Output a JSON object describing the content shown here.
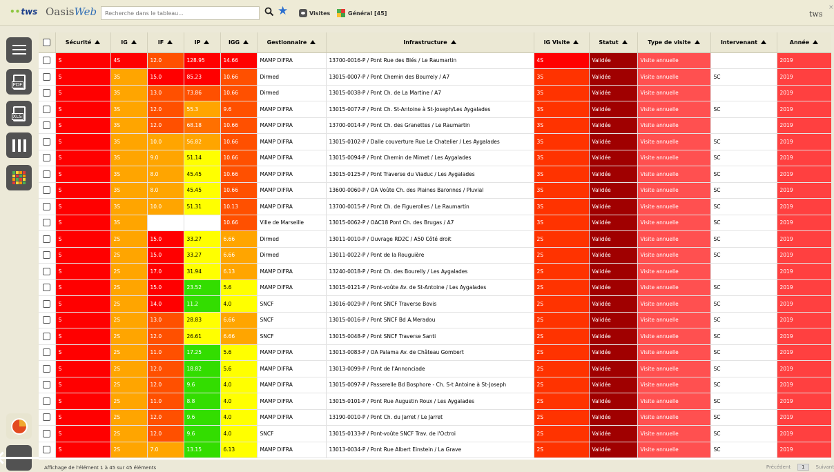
{
  "header": {
    "brand_tws": "tws",
    "brand_oasis": "Oasis",
    "brand_web": "Web",
    "search_placeholder": "Recherche dans le tableau...",
    "visites_label": "Visites",
    "general_label": "Général [45]",
    "user_label": "tws",
    "close_label": "×",
    "star_color": "#2c70cf"
  },
  "sidebar": {
    "items": [
      "menu-icon",
      "pdf-export-icon",
      "xls-export-icon",
      "columns-icon",
      "heatmap-icon",
      "pie-chart-icon",
      "back-arrow-icon"
    ],
    "pdf_tag": "PDF",
    "xls_tag": "XLS"
  },
  "table": {
    "columns": [
      "Sécurité",
      "IG",
      "IF",
      "IP",
      "IGG",
      "Gestionnaire",
      "Infrastructure",
      "IG Visite",
      "Statut",
      "Type de visite",
      "Intervenant",
      "Année"
    ],
    "rows": [
      {
        "securite": "S",
        "ig": "4S",
        "if": "12.0",
        "ip": "128.95",
        "igg": "14.66",
        "gest": "MAMP DIFRA",
        "infra": "13700-0016-P / Pont Rue des Blés / Le Raumartin",
        "igv": "4S",
        "statut": "Validée",
        "type": "Visite annuelle",
        "interv": "",
        "annee": "2019",
        "c_ig": "#ff0000",
        "c_if": "#ff5000",
        "c_ip": "#ff0000",
        "c_igg": "#ff0000",
        "c_igv": "#ff0000"
      },
      {
        "securite": "S",
        "ig": "3S",
        "if": "15.0",
        "ip": "85.23",
        "igg": "10.66",
        "gest": "Dirmed",
        "infra": "13015-0007-P / Pont Chemin des Bourrely / A7",
        "igv": "3S",
        "statut": "Validée",
        "type": "Visite annuelle",
        "interv": "SC",
        "annee": "2019",
        "c_ig": "#ffa500",
        "c_if": "#ff0000",
        "c_ip": "#ff0000",
        "c_igg": "#ff5000",
        "c_igv": "#ff3300"
      },
      {
        "securite": "S",
        "ig": "3S",
        "if": "13.0",
        "ip": "73.86",
        "igg": "10.66",
        "gest": "Dirmed",
        "infra": "13015-0038-P / Pont Ch. de La Martine / A7",
        "igv": "3S",
        "statut": "Validée",
        "type": "Visite annuelle",
        "interv": "",
        "annee": "2019",
        "c_ig": "#ffa500",
        "c_if": "#ff5000",
        "c_ip": "#ff5000",
        "c_igg": "#ff5000",
        "c_igv": "#ff3300"
      },
      {
        "securite": "S",
        "ig": "3S",
        "if": "12.0",
        "ip": "55.3",
        "igg": "9.6",
        "gest": "MAMP DIFRA",
        "infra": "13015-0077-P / Pont Ch. St-Antoine à St-Joseph/Les Aygalades",
        "igv": "3S",
        "statut": "Validée",
        "type": "Visite annuelle",
        "interv": "SC",
        "annee": "2019",
        "c_ig": "#ffa500",
        "c_if": "#ff5000",
        "c_ip": "#ffa500",
        "c_igg": "#ff5000",
        "c_igv": "#ff3300"
      },
      {
        "securite": "S",
        "ig": "3S",
        "if": "12.0",
        "ip": "68.18",
        "igg": "10.66",
        "gest": "MAMP DIFRA",
        "infra": "13700-0014-P / Pont Ch. des Granettes / Le Raumartin",
        "igv": "3S",
        "statut": "Validée",
        "type": "Visite annuelle",
        "interv": "",
        "annee": "2019",
        "c_ig": "#ffa500",
        "c_if": "#ff5000",
        "c_ip": "#ff7000",
        "c_igg": "#ff5000",
        "c_igv": "#ff3300"
      },
      {
        "securite": "S",
        "ig": "3S",
        "if": "10.0",
        "ip": "56.82",
        "igg": "10.66",
        "gest": "MAMP DIFRA",
        "infra": "13015-0102-P / Dalle couverture Rue Le Chatelier / Les Aygalades",
        "igv": "3S",
        "statut": "Validée",
        "type": "Visite annuelle",
        "interv": "SC",
        "annee": "2019",
        "c_ig": "#ffa500",
        "c_if": "#ffa500",
        "c_ip": "#ffa500",
        "c_igg": "#ff5000",
        "c_igv": "#ff3300"
      },
      {
        "securite": "S",
        "ig": "3S",
        "if": "9.0",
        "ip": "51.14",
        "igg": "10.66",
        "gest": "MAMP DIFRA",
        "infra": "13015-0094-P / Pont Chemin de Mimet / Les Aygalades",
        "igv": "3S",
        "statut": "Validée",
        "type": "Visite annuelle",
        "interv": "SC",
        "annee": "2019",
        "c_ig": "#ffa500",
        "c_if": "#ffa500",
        "c_ip": "#ffff00",
        "c_igg": "#ff5000",
        "c_igv": "#ff3300"
      },
      {
        "securite": "S",
        "ig": "3S",
        "if": "8.0",
        "ip": "45.45",
        "igg": "10.66",
        "gest": "MAMP DIFRA",
        "infra": "13015-0125-P / Pont Traverse du Viaduc / Les Aygalades",
        "igv": "3S",
        "statut": "Validée",
        "type": "Visite annuelle",
        "interv": "SC",
        "annee": "2019",
        "c_ig": "#ffa500",
        "c_if": "#ffa500",
        "c_ip": "#ffff00",
        "c_igg": "#ff5000",
        "c_igv": "#ff3300"
      },
      {
        "securite": "S",
        "ig": "3S",
        "if": "8.0",
        "ip": "45.45",
        "igg": "10.66",
        "gest": "MAMP DIFRA",
        "infra": "13600-0060-P / OA Voûte Ch. des Plaines Baronnes / Pluvial",
        "igv": "3S",
        "statut": "Validée",
        "type": "Visite annuelle",
        "interv": "SC",
        "annee": "2019",
        "c_ig": "#ffa500",
        "c_if": "#ffa500",
        "c_ip": "#ffff00",
        "c_igg": "#ff5000",
        "c_igv": "#ff3300"
      },
      {
        "securite": "S",
        "ig": "3S",
        "if": "10.0",
        "ip": "51.31",
        "igg": "10.13",
        "gest": "MAMP DIFRA",
        "infra": "13700-0015-P / Pont Ch. de Figuerolles / Le Raumartin",
        "igv": "3S",
        "statut": "Validée",
        "type": "Visite annuelle",
        "interv": "SC",
        "annee": "2019",
        "c_ig": "#ffa500",
        "c_if": "#ffa500",
        "c_ip": "#ffff00",
        "c_igg": "#ff5000",
        "c_igv": "#ff3300"
      },
      {
        "securite": "S",
        "ig": "3S",
        "if": "",
        "ip": "",
        "igg": "10.66",
        "gest": "Ville de Marseille",
        "infra": "13015-0062-P / OAC18 Pont Ch. des Brugas / A7",
        "igv": "3S",
        "statut": "Validée",
        "type": "Visite annuelle",
        "interv": "SC",
        "annee": "2019",
        "c_ig": "#ffa500",
        "c_if": "#ffffff",
        "c_ip": "#ffffff",
        "c_igg": "#ff5000",
        "c_igv": "#ff3300"
      },
      {
        "securite": "S",
        "ig": "2S",
        "if": "15.0",
        "ip": "33.27",
        "igg": "6.66",
        "gest": "Dirmed",
        "infra": "13011-0010-P / Ouvrage RD2C / A50 Côté droit",
        "igv": "2S",
        "statut": "Validée",
        "type": "Visite annuelle",
        "interv": "SC",
        "annee": "2019",
        "c_ig": "#ffa500",
        "c_if": "#ff0000",
        "c_ip": "#ffff00",
        "c_igg": "#ffa500",
        "c_igv": "#ff3300"
      },
      {
        "securite": "S",
        "ig": "2S",
        "if": "15.0",
        "ip": "33.27",
        "igg": "6.66",
        "gest": "Dirmed",
        "infra": "13011-0022-P / Pont de la Rouguière",
        "igv": "2S",
        "statut": "Validée",
        "type": "Visite annuelle",
        "interv": "SC",
        "annee": "2019",
        "c_ig": "#ffa500",
        "c_if": "#ff0000",
        "c_ip": "#ffff00",
        "c_igg": "#ffa500",
        "c_igv": "#ff3300"
      },
      {
        "securite": "S",
        "ig": "2S",
        "if": "17.0",
        "ip": "31.94",
        "igg": "6.13",
        "gest": "MAMP DIFRA",
        "infra": "13240-0018-P / Pont Ch. des Bourelly / Les Aygalades",
        "igv": "2S",
        "statut": "Validée",
        "type": "Visite annuelle",
        "interv": "",
        "annee": "2019",
        "c_ig": "#ffa500",
        "c_if": "#ff0000",
        "c_ip": "#ffff00",
        "c_igg": "#ffa500",
        "c_igv": "#ff3300"
      },
      {
        "securite": "S",
        "ig": "2S",
        "if": "15.0",
        "ip": "23.52",
        "igg": "5.6",
        "gest": "MAMP DIFRA",
        "infra": "13015-0121-P / Pont-voûte Av. de St-Antoine / Les Aygalades",
        "igv": "2S",
        "statut": "Validée",
        "type": "Visite annuelle",
        "interv": "SC",
        "annee": "2019",
        "c_ig": "#ffa500",
        "c_if": "#ff0000",
        "c_ip": "#33dd00",
        "c_igg": "#ffff00",
        "c_igv": "#ff3300"
      },
      {
        "securite": "S",
        "ig": "2S",
        "if": "14.0",
        "ip": "11.2",
        "igg": "4.0",
        "gest": "SNCF",
        "infra": "13016-0029-P / Pont SNCF Traverse Bovis",
        "igv": "2S",
        "statut": "Validée",
        "type": "Visite annuelle",
        "interv": "SC",
        "annee": "2019",
        "c_ig": "#ffa500",
        "c_if": "#ff0000",
        "c_ip": "#33dd00",
        "c_igg": "#ffff00",
        "c_igv": "#ff3300"
      },
      {
        "securite": "S",
        "ig": "2S",
        "if": "13.0",
        "ip": "28.83",
        "igg": "6.66",
        "gest": "SNCF",
        "infra": "13015-0016-P / Pont SNCF Bd A.Meradou",
        "igv": "2S",
        "statut": "Validée",
        "type": "Visite annuelle",
        "interv": "SC",
        "annee": "2019",
        "c_ig": "#ffa500",
        "c_if": "#ff5000",
        "c_ip": "#ffff00",
        "c_igg": "#ffa500",
        "c_igv": "#ff3300"
      },
      {
        "securite": "S",
        "ig": "2S",
        "if": "12.0",
        "ip": "26.61",
        "igg": "6.66",
        "gest": "SNCF",
        "infra": "13015-0048-P / Pont SNCF Traverse Santi",
        "igv": "2S",
        "statut": "Validée",
        "type": "Visite annuelle",
        "interv": "SC",
        "annee": "2019",
        "c_ig": "#ffa500",
        "c_if": "#ff5000",
        "c_ip": "#ffff00",
        "c_igg": "#ffa500",
        "c_igv": "#ff3300"
      },
      {
        "securite": "S",
        "ig": "2S",
        "if": "11.0",
        "ip": "17.25",
        "igg": "5.6",
        "gest": "MAMP DIFRA",
        "infra": "13013-0083-P / OA Palama Av. de Château Gombert",
        "igv": "2S",
        "statut": "Validée",
        "type": "Visite annuelle",
        "interv": "SC",
        "annee": "2019",
        "c_ig": "#ffa500",
        "c_if": "#ff5000",
        "c_ip": "#33dd00",
        "c_igg": "#ffff00",
        "c_igv": "#ff3300"
      },
      {
        "securite": "S",
        "ig": "2S",
        "if": "12.0",
        "ip": "18.82",
        "igg": "5.6",
        "gest": "MAMP DIFRA",
        "infra": "13013-0099-P / Pont de l'Annonciade",
        "igv": "2S",
        "statut": "Validée",
        "type": "Visite annuelle",
        "interv": "SC",
        "annee": "2019",
        "c_ig": "#ffa500",
        "c_if": "#ff5000",
        "c_ip": "#33dd00",
        "c_igg": "#ffff00",
        "c_igv": "#ff3300"
      },
      {
        "securite": "S",
        "ig": "2S",
        "if": "12.0",
        "ip": "9.6",
        "igg": "4.0",
        "gest": "MAMP DIFRA",
        "infra": "13015-0097-P / Passerelle Bd Bosphore - Ch. S-t Antoine à St-Joseph",
        "igv": "2S",
        "statut": "Validée",
        "type": "Visite annuelle",
        "interv": "SC",
        "annee": "2019",
        "c_ig": "#ffa500",
        "c_if": "#ff5000",
        "c_ip": "#33dd00",
        "c_igg": "#ffff00",
        "c_igv": "#ff3300"
      },
      {
        "securite": "S",
        "ig": "2S",
        "if": "11.0",
        "ip": "8.8",
        "igg": "4.0",
        "gest": "MAMP DIFRA",
        "infra": "13015-0101-P / Pont Rue Augustin Roux / Les Aygalades",
        "igv": "2S",
        "statut": "Validée",
        "type": "Visite annuelle",
        "interv": "SC",
        "annee": "2019",
        "c_ig": "#ffa500",
        "c_if": "#ff5000",
        "c_ip": "#33dd00",
        "c_igg": "#ffff00",
        "c_igv": "#ff3300"
      },
      {
        "securite": "S",
        "ig": "2S",
        "if": "12.0",
        "ip": "9.6",
        "igg": "4.0",
        "gest": "MAMP DIFRA",
        "infra": "13190-0010-P / Pont Ch. du Jarret / Le Jarret",
        "igv": "2S",
        "statut": "Validée",
        "type": "Visite annuelle",
        "interv": "SC",
        "annee": "2019",
        "c_ig": "#ffa500",
        "c_if": "#ff5000",
        "c_ip": "#33dd00",
        "c_igg": "#ffff00",
        "c_igv": "#ff3300"
      },
      {
        "securite": "S",
        "ig": "2S",
        "if": "12.0",
        "ip": "9.6",
        "igg": "4.0",
        "gest": "SNCF",
        "infra": "13015-0133-P / Pont-voûte SNCF Trav. de l'Octroi",
        "igv": "2S",
        "statut": "Validée",
        "type": "Visite annuelle",
        "interv": "SC",
        "annee": "2019",
        "c_ig": "#ffa500",
        "c_if": "#ff5000",
        "c_ip": "#33dd00",
        "c_igg": "#ffff00",
        "c_igv": "#ff3300"
      },
      {
        "securite": "S",
        "ig": "2S",
        "if": "7.0",
        "ip": "13.15",
        "igg": "6.13",
        "gest": "MAMP DIFRA",
        "infra": "13013-0034-P / Pont Rue Albert Einstein / La Grave",
        "igv": "2S",
        "statut": "Validée",
        "type": "Visite annuelle",
        "interv": "SC",
        "annee": "2019",
        "c_ig": "#ffa500",
        "c_if": "#ffa500",
        "c_ip": "#33dd00",
        "c_igg": "#ffff00",
        "c_igv": "#ff3300"
      }
    ],
    "colors": {
      "securite": "#ff0000",
      "statut": "#a00000",
      "type": "#ff5050",
      "annee": "#ff4040"
    }
  },
  "footer": {
    "info": "Affichage de l'élément 1 à 45 sur 45 éléments",
    "prev": "Précédent",
    "page": "1",
    "next": "Suivant"
  }
}
